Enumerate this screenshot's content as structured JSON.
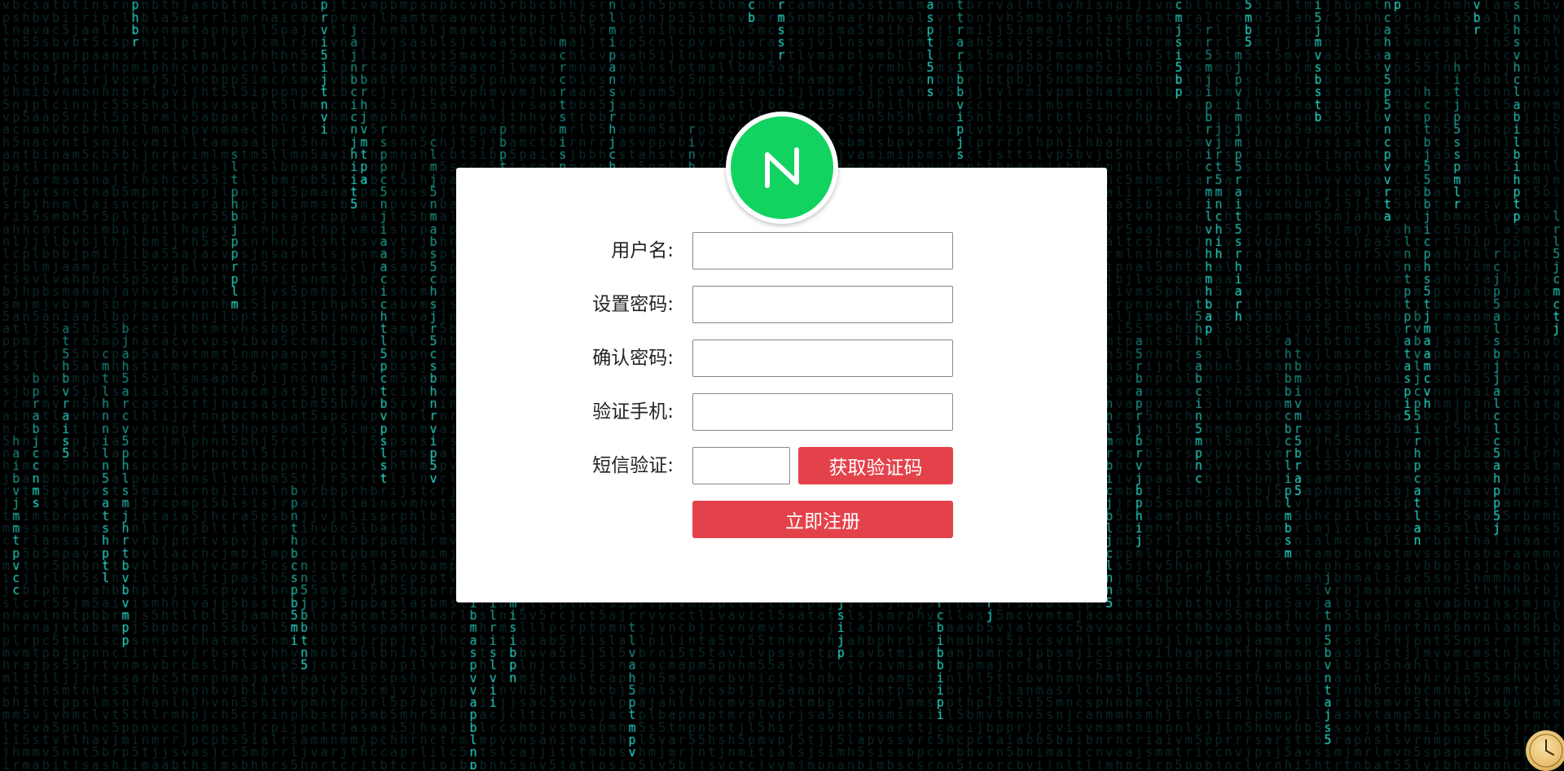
{
  "theme": {
    "accent": "#e4424b",
    "logo_color": "#12d35f",
    "rain_color_bright": "#27e6d6",
    "rain_color_dim": "#0f3b3a",
    "background": "#000000"
  },
  "logo": {
    "icon": "n-logo-icon"
  },
  "form": {
    "username_label": "用户名:",
    "username_value": "",
    "password_label": "设置密码:",
    "password_value": "",
    "confirm_label": "确认密码:",
    "confirm_value": "",
    "phone_label": "验证手机:",
    "phone_value": "",
    "sms_label": "短信验证:",
    "sms_value": "",
    "get_code_button": "获取验证码",
    "submit_button": "立即注册"
  },
  "background_rain": {
    "charset": "ab5cjhilmnprstv"
  },
  "widget": {
    "icon": "clock-icon"
  }
}
